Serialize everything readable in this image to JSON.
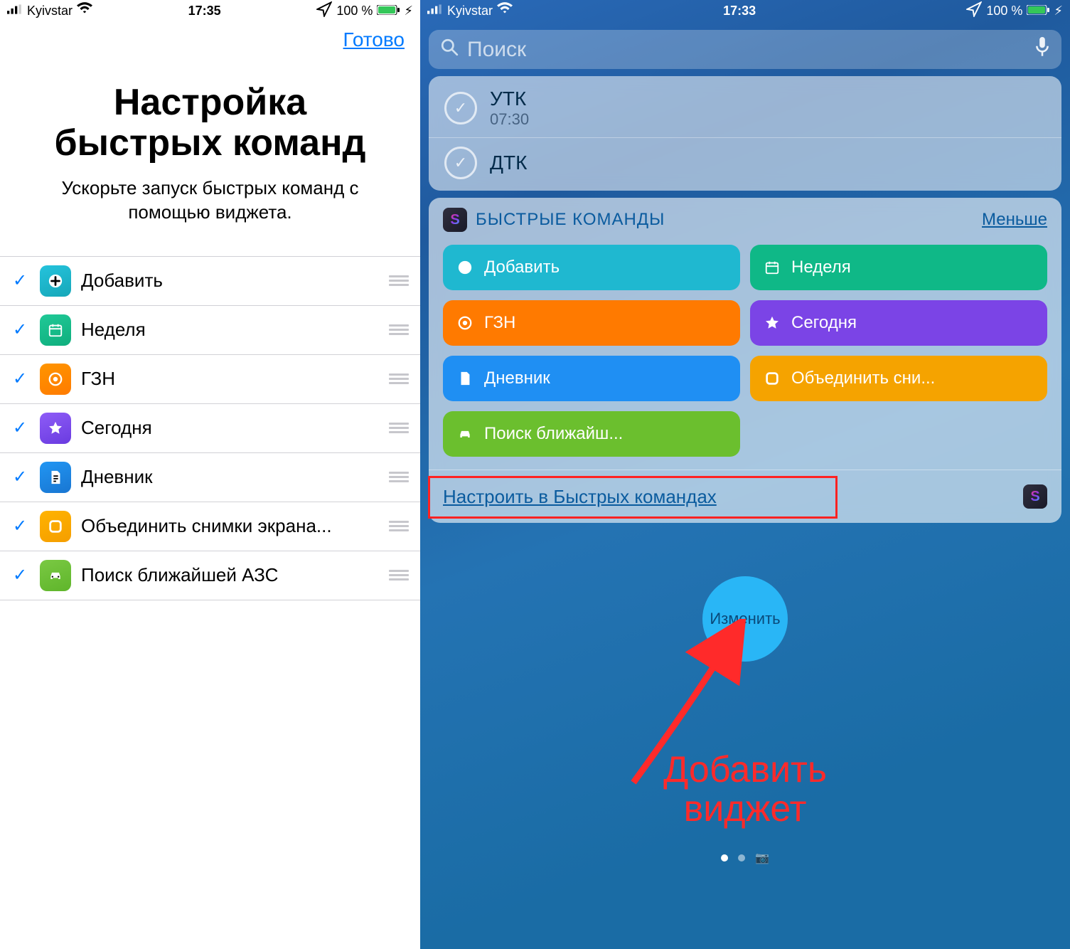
{
  "left": {
    "status": {
      "carrier": "Kyivstar",
      "time": "17:35",
      "battery": "100 %"
    },
    "done": "Готово",
    "title_line1": "Настройка",
    "title_line2": "быстрых команд",
    "subtitle": "Ускорьте запуск быстрых команд с помощью виджета.",
    "items": [
      {
        "label": "Добавить",
        "icon": "plus-icon",
        "color": "teal"
      },
      {
        "label": "Неделя",
        "icon": "calendar-icon",
        "color": "grn"
      },
      {
        "label": "ГЗН",
        "icon": "target-icon",
        "color": "org"
      },
      {
        "label": "Сегодня",
        "icon": "star-icon",
        "color": "prp"
      },
      {
        "label": "Дневник",
        "icon": "doc-icon",
        "color": "blu"
      },
      {
        "label": "Объединить снимки экрана...",
        "icon": "square-icon",
        "color": "yel"
      },
      {
        "label": "Поиск ближайшей АЗС",
        "icon": "car-icon",
        "color": "lime"
      }
    ]
  },
  "right": {
    "status": {
      "carrier": "Kyivstar",
      "time": "17:33",
      "battery": "100 %"
    },
    "search_placeholder": "Поиск",
    "top_card": [
      {
        "title": "УТК",
        "sub": "07:30"
      },
      {
        "title": "ДТК",
        "sub": ""
      }
    ],
    "widget": {
      "title": "БЫСТРЫЕ КОМАНДЫ",
      "less": "Меньше",
      "chips": [
        {
          "label": "Добавить",
          "icon": "plus-icon",
          "color": "teal"
        },
        {
          "label": "Неделя",
          "icon": "calendar-icon",
          "color": "grn"
        },
        {
          "label": "ГЗН",
          "icon": "target-icon",
          "color": "org"
        },
        {
          "label": "Сегодня",
          "icon": "star-icon",
          "color": "prp"
        },
        {
          "label": "Дневник",
          "icon": "doc-icon",
          "color": "blu"
        },
        {
          "label": "Объединить сни...",
          "icon": "square-icon",
          "color": "yel"
        },
        {
          "label": "Поиск ближайш...",
          "icon": "car-icon",
          "color": "lime"
        }
      ],
      "configure": "Настроить в Быстрых командах"
    },
    "edit_button": "Изменить",
    "annotation_line1": "Добавить",
    "annotation_line2": "виджет"
  }
}
